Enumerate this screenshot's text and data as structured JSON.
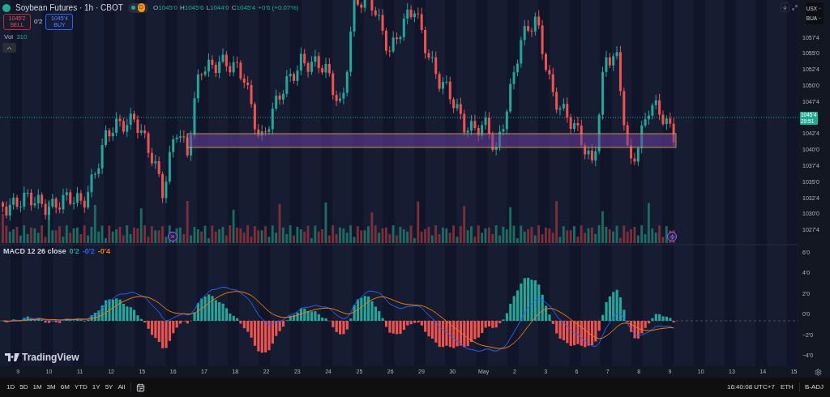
{
  "header": {
    "title": "Soybean Futures · 1h · CBOT",
    "market_badge": "D",
    "ohlc": [
      {
        "label": "O",
        "value": "1045'0"
      },
      {
        "label": "H",
        "value": "1045'6"
      },
      {
        "label": "L",
        "value": "1044'0"
      },
      {
        "label": "C",
        "value": "1045'4"
      }
    ],
    "change": "+0'6 (+0.07%)"
  },
  "trade": {
    "sell": {
      "price": "1045'2",
      "label": "SELL"
    },
    "spread": "0'2",
    "buy": {
      "price": "1045'4",
      "label": "BUY"
    }
  },
  "volume": {
    "label": "Vol",
    "value": "310"
  },
  "top_right": {
    "currency": "USX",
    "contract": "BUA"
  },
  "price_axis": [
    "1057'4",
    "1055'0",
    "1052'4",
    "1050'0",
    "1047'4",
    "1042'4",
    "1040'0",
    "1037'4",
    "1035'0",
    "1032'4",
    "1030'0",
    "1027'4"
  ],
  "last_price": {
    "price": "1045'4",
    "countdown": "29:51"
  },
  "macd": {
    "label": "MACD 12 26 close",
    "values": [
      {
        "text": "0'2",
        "color": "#22ab94"
      },
      {
        "text": "-0'2",
        "color": "#2962ff"
      },
      {
        "text": "-0'4",
        "color": "#f57c00"
      }
    ],
    "axis": [
      "6'0",
      "4'0",
      "2'0",
      "0'0",
      "−2'0",
      "−4'0"
    ]
  },
  "logo": "TradingView",
  "time_axis": [
    "9",
    "10",
    "11",
    "12",
    "15",
    "16",
    "17",
    "18",
    "22",
    "23",
    "24",
    "25",
    "26",
    "29",
    "30",
    "May",
    "2",
    "3",
    "6",
    "7",
    "8",
    "9",
    "10",
    "13",
    "14",
    "15"
  ],
  "ranges": [
    "1D",
    "5D",
    "1M",
    "3M",
    "6M",
    "YTD",
    "1Y",
    "5Y",
    "All"
  ],
  "clock": "16:40:08 UTC+7",
  "session": "ETH",
  "adjustment": "B-ADJ"
}
